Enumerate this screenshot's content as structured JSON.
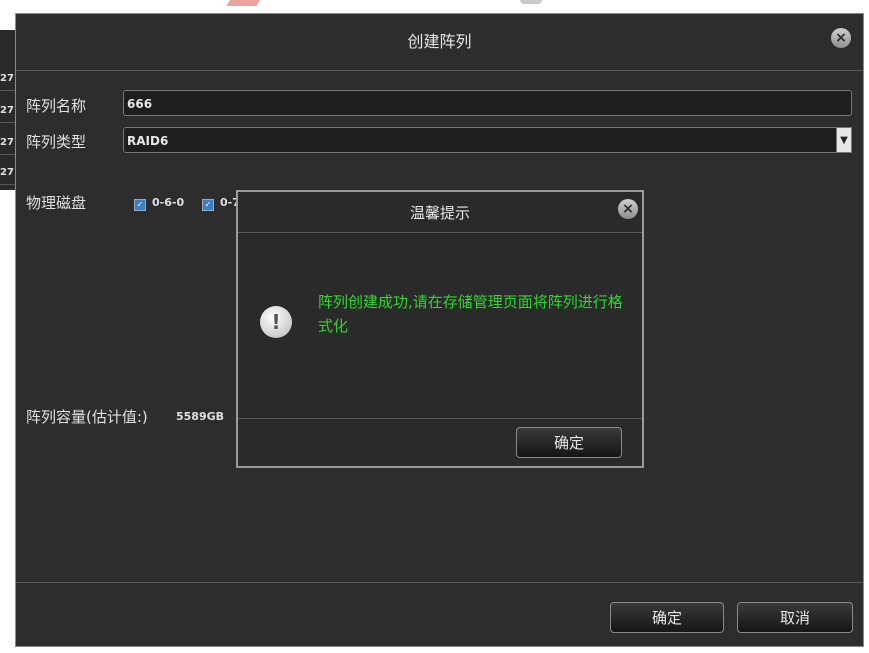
{
  "background": {
    "rows": [
      "27",
      "27",
      "27",
      "27"
    ]
  },
  "dialog": {
    "title": "创建阵列",
    "close_icon": "close-icon",
    "fields": {
      "name_label": "阵列名称",
      "name_value": "666",
      "type_label": "阵列类型",
      "type_value": "RAID6",
      "disks_label": "物理磁盘",
      "disks": [
        "0-6-0",
        "0-7"
      ],
      "capacity_label": "阵列容量(估计值:)",
      "capacity_value": "5589GB"
    },
    "buttons": {
      "ok": "确定",
      "cancel": "取消"
    }
  },
  "alert": {
    "title": "温馨提示",
    "icon": "warning-icon",
    "message": "阵列创建成功,请在存储管理页面将阵列进行格式化",
    "ok": "确定"
  },
  "colors": {
    "message": "#33d433",
    "panel": "#2d2d2d"
  }
}
